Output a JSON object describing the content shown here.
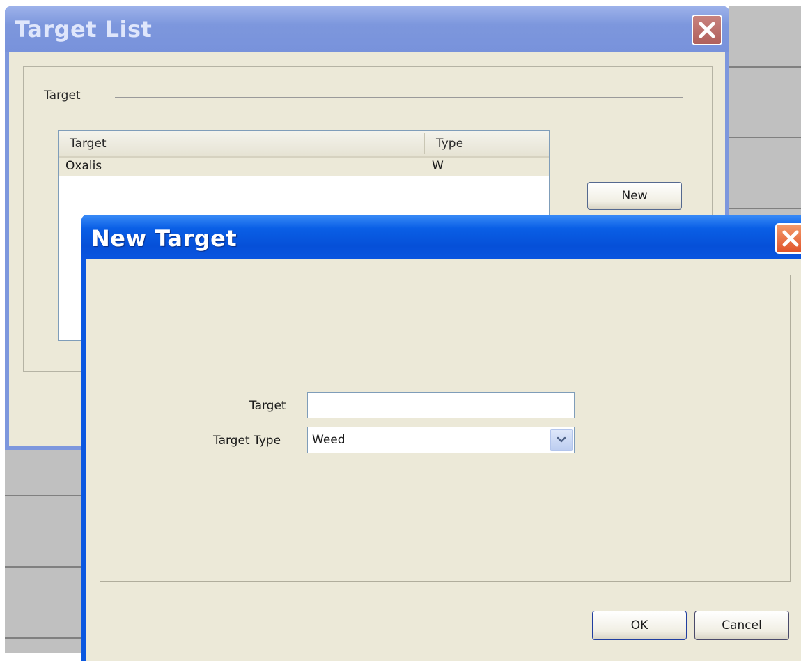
{
  "target_list": {
    "title": "Target List",
    "group_label": "Target",
    "table": {
      "columns": [
        "Target",
        "Type"
      ],
      "rows": [
        {
          "target": "Oxalis",
          "type": "W"
        }
      ]
    },
    "new_button": "New"
  },
  "new_target": {
    "title": "New Target",
    "target_label": "Target",
    "target_value": "",
    "target_type_label": "Target Type",
    "target_type_value": "Weed",
    "ok_button": "OK",
    "cancel_button": "Cancel"
  },
  "icons": {
    "close": "close-icon",
    "dropdown": "chevron-down-icon"
  },
  "colors": {
    "inactive_titlebar": "#7d97dd",
    "active_titlebar": "#0a57e0",
    "client_background": "#ece9d8"
  }
}
